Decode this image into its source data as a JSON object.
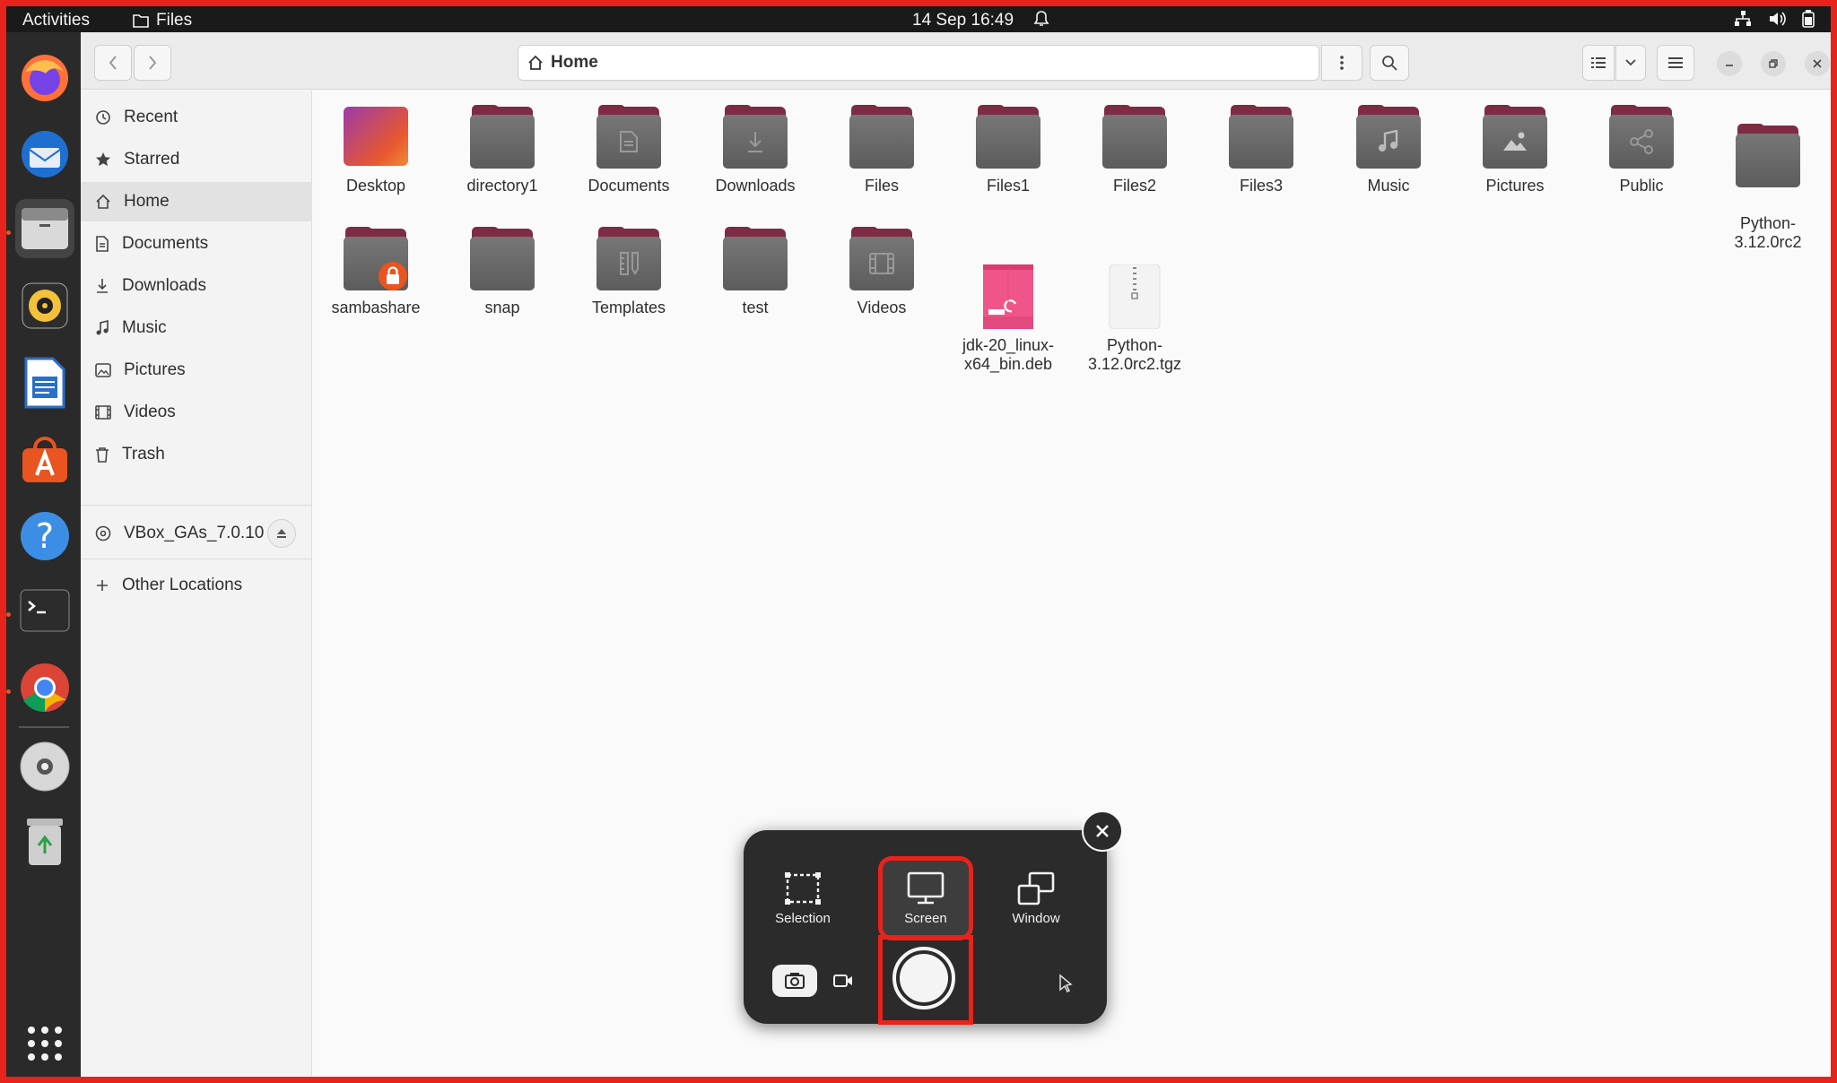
{
  "topbar": {
    "activities": "Activities",
    "app_name": "Files",
    "clock": "14 Sep  16:49"
  },
  "dock": {
    "items": [
      {
        "name": "firefox-icon"
      },
      {
        "name": "thunderbird-icon"
      },
      {
        "name": "files-icon"
      },
      {
        "name": "rhythmbox-icon"
      },
      {
        "name": "writer-icon"
      },
      {
        "name": "app-center-icon"
      },
      {
        "name": "help-icon"
      },
      {
        "name": "terminal-icon"
      },
      {
        "name": "chrome-icon"
      },
      {
        "name": "disc-icon"
      },
      {
        "name": "trash-icon"
      },
      {
        "name": "app-grid-icon"
      }
    ]
  },
  "header": {
    "path": "Home"
  },
  "sidebar": {
    "recent": "Recent",
    "starred": "Starred",
    "home": "Home",
    "documents": "Documents",
    "downloads": "Downloads",
    "music": "Music",
    "pictures": "Pictures",
    "videos": "Videos",
    "trash": "Trash",
    "device": "VBox_GAs_7.0.10",
    "other": "Other Locations"
  },
  "files": {
    "desktop": "Desktop",
    "directory1": "directory1",
    "documents": "Documents",
    "downloads": "Downloads",
    "files": "Files",
    "files1": "Files1",
    "files2": "Files2",
    "files3": "Files3",
    "music": "Music",
    "pictures": "Pictures",
    "public": "Public",
    "python_dir": "Python-\n3.12.0rc2",
    "sambashare": "sambashare",
    "snap": "snap",
    "templates": "Templates",
    "test": "test",
    "videos": "Videos",
    "jdk": "jdk-20_linux-\nx64_bin.deb",
    "python_tgz": "Python-\n3.12.0rc2.tgz"
  },
  "screenshot_ui": {
    "selection": "Selection",
    "screen": "Screen",
    "window": "Window"
  },
  "colors": {
    "accent": "#e95420",
    "highlight_border": "#e8231b",
    "folder_tab": "#7d2a44"
  }
}
